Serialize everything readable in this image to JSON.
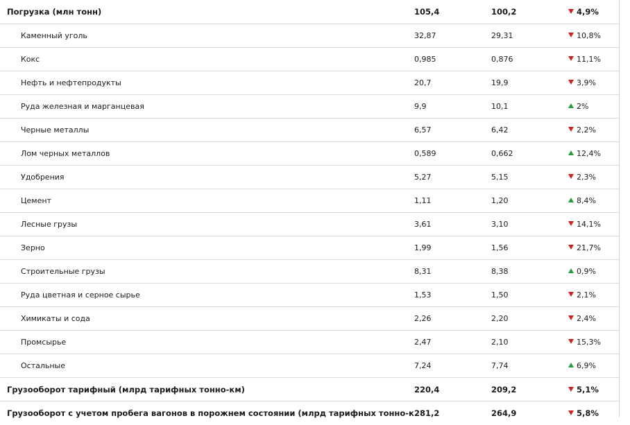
{
  "colors": {
    "down": "#cc2222",
    "up": "#2a9a3a"
  },
  "rows": [
    {
      "name": "Погрузка (млн тонн)",
      "v1": "105,4",
      "v2": "100,2",
      "dir": "down",
      "change": "4,9%",
      "bold": true
    },
    {
      "name": "Каменный уголь",
      "v1": "32,87",
      "v2": "29,31",
      "dir": "down",
      "change": "10,8%"
    },
    {
      "name": "Кокс",
      "v1": "0,985",
      "v2": "0,876",
      "dir": "down",
      "change": "11,1%"
    },
    {
      "name": "Нефть и нефтепродукты",
      "v1": "20,7",
      "v2": "19,9",
      "dir": "down",
      "change": "3,9%"
    },
    {
      "name": "Руда железная и марганцевая",
      "v1": "9,9",
      "v2": "10,1",
      "dir": "up",
      "change": "2%"
    },
    {
      "name": "Черные металлы",
      "v1": "6,57",
      "v2": "6,42",
      "dir": "down",
      "change": "2,2%"
    },
    {
      "name": "Лом черных металлов",
      "v1": "0,589",
      "v2": "0,662",
      "dir": "up",
      "change": "12,4%"
    },
    {
      "name": "Удобрения",
      "v1": "5,27",
      "v2": "5,15",
      "dir": "down",
      "change": "2,3%"
    },
    {
      "name": "Цемент",
      "v1": "1,11",
      "v2": "1,20",
      "dir": "up",
      "change": "8,4%"
    },
    {
      "name": "Лесные грузы",
      "v1": "3,61",
      "v2": "3,10",
      "dir": "down",
      "change": "14,1%"
    },
    {
      "name": "Зерно",
      "v1": "1,99",
      "v2": "1,56",
      "dir": "down",
      "change": "21,7%"
    },
    {
      "name": "Строительные грузы",
      "v1": "8,31",
      "v2": "8,38",
      "dir": "up",
      "change": "0,9%"
    },
    {
      "name": "Руда цветная и серное сырье",
      "v1": "1,53",
      "v2": "1,50",
      "dir": "down",
      "change": "2,1%"
    },
    {
      "name": "Химикаты и сода",
      "v1": "2,26",
      "v2": "2,20",
      "dir": "down",
      "change": "2,4%"
    },
    {
      "name": "Промсырье",
      "v1": "2,47",
      "v2": "2,10",
      "dir": "down",
      "change": "15,3%"
    },
    {
      "name": "Остальные",
      "v1": "7,24",
      "v2": "7,74",
      "dir": "up",
      "change": "6,9%"
    },
    {
      "name": "Грузооборот тарифный (млрд тарифных тонно-км)",
      "v1": "220,4",
      "v2": "209,2",
      "dir": "down",
      "change": "5,1%",
      "bold": true
    },
    {
      "name": "Грузооборот с учетом пробега вагонов в порожнем состоянии (млрд тарифных тонно-км)",
      "v1": "281,2",
      "v2": "264,9",
      "dir": "down",
      "change": "5,8%",
      "bold": true
    }
  ]
}
